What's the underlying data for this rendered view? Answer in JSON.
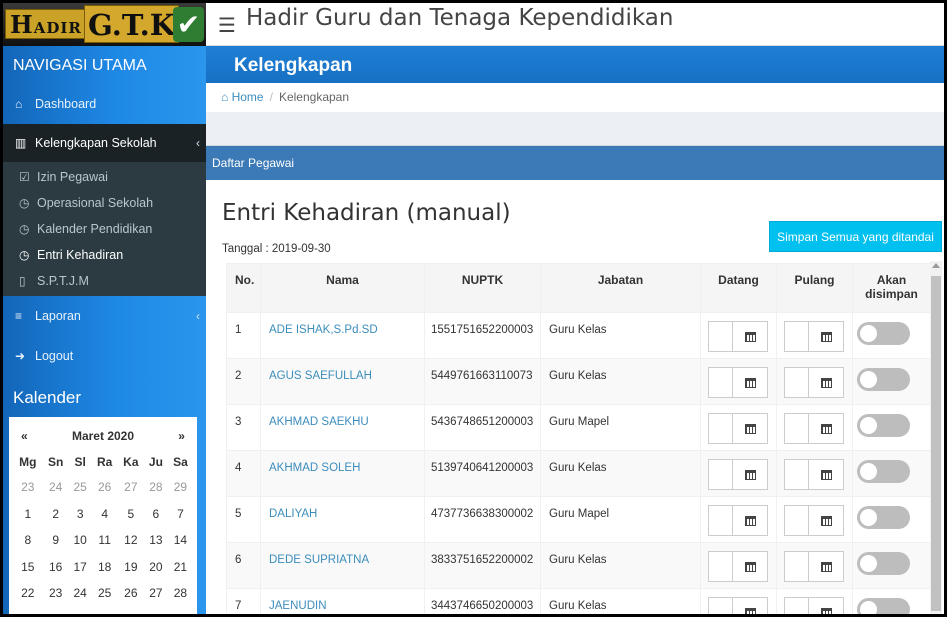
{
  "app": {
    "logo_text_hadir_h": "H",
    "logo_text_hadir_rest": "ADIR",
    "logo_text_gtk": "G.T.K",
    "title": "Hadir Guru dan Tenaga Kependidikan"
  },
  "sidebar": {
    "nav_header": "NAVIGASI UTAMA",
    "items": [
      {
        "icon": "home-icon",
        "glyph": "⌂",
        "label": "Dashboard"
      },
      {
        "icon": "bank-icon",
        "glyph": "🏛",
        "label": "Kelengkapan Sekolah"
      },
      {
        "icon": "list-icon",
        "glyph": "≡",
        "label": "Laporan"
      },
      {
        "icon": "logout-icon",
        "glyph": "➜",
        "label": "Logout"
      }
    ],
    "subitems": [
      {
        "icon": "calendar-check-icon",
        "glyph": "☑",
        "label": "Izin Pegawai"
      },
      {
        "icon": "clock-icon",
        "glyph": "◷",
        "label": "Operasional Sekolah"
      },
      {
        "icon": "clock-icon",
        "glyph": "◷",
        "label": "Kalender Pendidikan"
      },
      {
        "icon": "clock-icon",
        "glyph": "◷",
        "label": "Entri Kehadiran"
      },
      {
        "icon": "file-icon",
        "glyph": "▯",
        "label": "S.P.T.J.M"
      }
    ],
    "calendar_header": "Kalender"
  },
  "calendar": {
    "prev": "«",
    "next": "»",
    "month": "Maret 2020",
    "weekdays": [
      "Mg",
      "Sn",
      "Sl",
      "Ra",
      "Ka",
      "Ju",
      "Sa"
    ],
    "weeks": [
      [
        "23",
        "24",
        "25",
        "26",
        "27",
        "28",
        "29"
      ],
      [
        "1",
        "2",
        "3",
        "4",
        "5",
        "6",
        "7"
      ],
      [
        "8",
        "9",
        "10",
        "11",
        "12",
        "13",
        "14"
      ],
      [
        "15",
        "16",
        "17",
        "18",
        "19",
        "20",
        "21"
      ],
      [
        "22",
        "23",
        "24",
        "25",
        "26",
        "27",
        "28"
      ]
    ]
  },
  "page": {
    "header": "Kelengkapan",
    "breadcrumb_home": "Home",
    "breadcrumb_current": "Kelengkapan",
    "box_title": "Daftar Pegawai",
    "entry_title": "Entri Kehadiran (manual)",
    "date_label": "Tanggal : 2019-09-30",
    "save_all_button": "Simpan Semua yang ditandai"
  },
  "table": {
    "headers": {
      "no": "No.",
      "nama": "Nama",
      "nuptk": "NUPTK",
      "jabatan": "Jabatan",
      "datang": "Datang",
      "pulang": "Pulang",
      "akan_1": "Akan",
      "akan_2": "disimpan"
    },
    "rows": [
      {
        "no": "1",
        "nama": "ADE ISHAK,S.Pd.SD",
        "nuptk": "1551751652200003",
        "jabatan": "Guru Kelas"
      },
      {
        "no": "2",
        "nama": "AGUS SAEFULLAH",
        "nuptk": "5449761663110073",
        "jabatan": "Guru Kelas"
      },
      {
        "no": "3",
        "nama": "AKHMAD SAEKHU",
        "nuptk": "5436748651200003",
        "jabatan": "Guru Mapel"
      },
      {
        "no": "4",
        "nama": "AKHMAD SOLEH",
        "nuptk": "5139740641200003",
        "jabatan": "Guru Kelas"
      },
      {
        "no": "5",
        "nama": "DALIYAH",
        "nuptk": "4737736638300002",
        "jabatan": "Guru Mapel"
      },
      {
        "no": "6",
        "nama": "DEDE SUPRIATNA",
        "nuptk": "3833751652200002",
        "jabatan": "Guru Kelas"
      },
      {
        "no": "7",
        "nama": "JAENUDIN",
        "nuptk": "3443746650200003",
        "jabatan": "Guru Kelas"
      }
    ]
  },
  "colors": {
    "sidebar_blue": "#1e88e5",
    "header_blue": "#1f7fd4",
    "box_header": "#3b7ab6",
    "button_cyan": "#00c0ef",
    "link_blue": "#3c8dbc"
  }
}
